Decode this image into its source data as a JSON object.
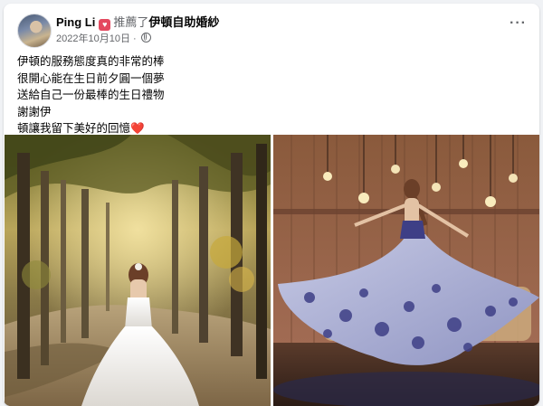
{
  "post": {
    "author": "Ping Li",
    "badge_icon": "heart-badge-icon",
    "action": "推薦了",
    "page_name": "伊頓自助婚紗",
    "date": "2022年10月10日",
    "separator": "·",
    "privacy_icon": "globe-icon",
    "more_label": "···",
    "text_lines": [
      "伊頓的服務態度真的非常的棒",
      "很開心能在生日前夕圓一個夢",
      "送給自己一份最棒的生日禮物",
      "謝謝伊",
      "頓讓我留下美好的回憶"
    ],
    "heart_emoji": "❤️"
  },
  "photos": [
    {
      "name": "bride-forest-photo"
    },
    {
      "name": "bride-blue-gown-photo"
    }
  ],
  "colors": {
    "background": "#f0f2f5",
    "card": "#ffffff",
    "secondary_text": "#65676b",
    "heart": "#e0245e"
  }
}
